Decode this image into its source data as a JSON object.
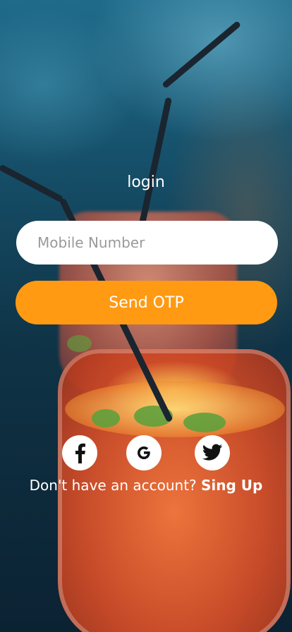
{
  "login": {
    "title": "login",
    "mobile_placeholder": "Mobile Number",
    "send_otp_label": "Send OTP"
  },
  "social": {
    "icons": [
      "facebook-icon",
      "google-icon",
      "twitter-icon"
    ]
  },
  "signup": {
    "prompt": "Don't have an account?",
    "link_label": "Sing Up"
  },
  "colors": {
    "accent": "#ff9a12",
    "input_bg": "#ffffff",
    "text": "#ffffff"
  }
}
